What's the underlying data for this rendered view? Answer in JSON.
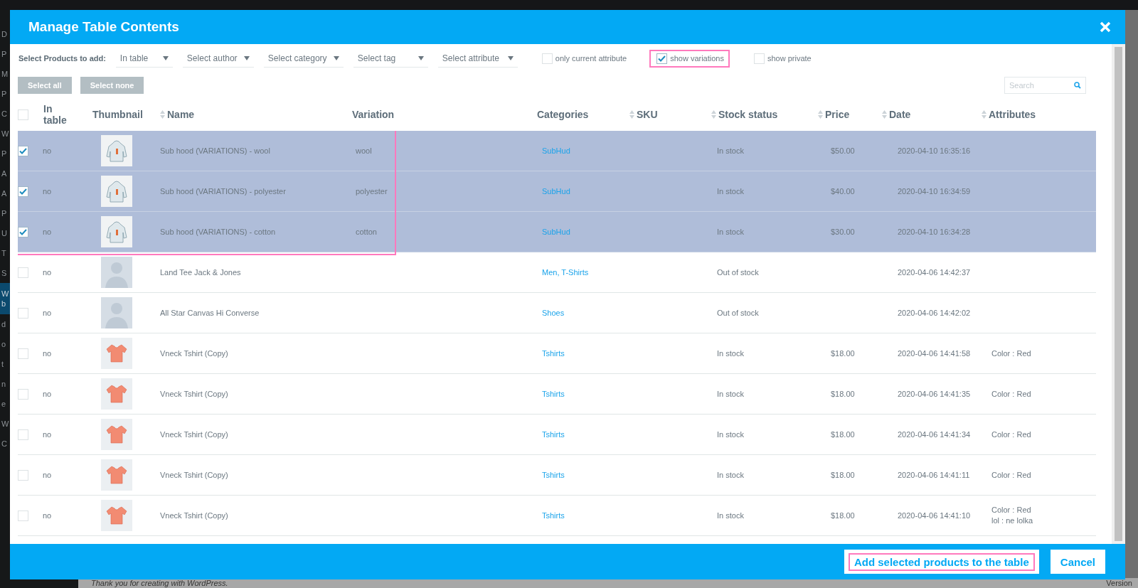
{
  "admin_sidebar": {
    "items": [
      {
        "label": "D",
        "current": false
      },
      {
        "label": "P",
        "current": false
      },
      {
        "label": "M",
        "current": false
      },
      {
        "label": "P",
        "current": false
      },
      {
        "label": "C",
        "current": false
      },
      {
        "label": "W",
        "current": false
      },
      {
        "label": "P",
        "current": false
      },
      {
        "label": "A",
        "current": false
      },
      {
        "label": "A",
        "current": false
      },
      {
        "label": "P",
        "current": false
      },
      {
        "label": "U",
        "current": false
      },
      {
        "label": "T",
        "current": false
      },
      {
        "label": "S",
        "current": false
      },
      {
        "label": "W\nb",
        "current": true
      },
      {
        "label": "d",
        "current": false
      },
      {
        "label": "o",
        "current": false
      },
      {
        "label": "t",
        "current": false
      },
      {
        "label": "n",
        "current": false
      },
      {
        "label": "e",
        "current": false
      },
      {
        "label": "W",
        "current": false
      },
      {
        "label": "C",
        "current": false
      }
    ]
  },
  "page_footer": {
    "text": "Thank you for creating with WordPress.",
    "version": "Version"
  },
  "dialog": {
    "title": "Manage Table Contents",
    "filters": {
      "label": "Select Products to add:",
      "dropdowns": [
        "In table",
        "Select author",
        "Select category",
        "Select tag",
        "Select attribute"
      ],
      "checkboxes": [
        {
          "label": "only current attribute",
          "checked": false,
          "highlighted": false
        },
        {
          "label": "show variations",
          "checked": true,
          "highlighted": true
        },
        {
          "label": "show private",
          "checked": false,
          "highlighted": false
        }
      ]
    },
    "buttons": [
      "Select all",
      "Select none"
    ],
    "search": {
      "placeholder": "Search"
    },
    "table": {
      "columns": [
        {
          "kind": "checkbox",
          "checked": false
        },
        {
          "label": "In table",
          "sortable": false
        },
        {
          "label": "Thumbnail",
          "sortable": false
        },
        {
          "label": "Name",
          "sortable": true
        },
        {
          "label": "Variation",
          "sortable": false
        },
        {
          "label": "Categories",
          "sortable": false
        },
        {
          "label": "SKU",
          "sortable": true
        },
        {
          "label": "Stock status",
          "sortable": true
        },
        {
          "label": "Price",
          "sortable": true
        },
        {
          "label": "Date",
          "sortable": true
        },
        {
          "label": "Attributes",
          "sortable": true
        }
      ],
      "rows": [
        {
          "selected": true,
          "highlighted": true,
          "in_table": "no",
          "thumbnail": {
            "kind": "hoodie"
          },
          "name": "Sub hood (VARIATIONS) - wool",
          "variation": "wool",
          "categories": "SubHud",
          "stock": "In stock",
          "price": "$50.00",
          "date": "2020-04-10 16:35:16",
          "attributes": []
        },
        {
          "selected": true,
          "highlighted": true,
          "in_table": "no",
          "thumbnail": {
            "kind": "hoodie"
          },
          "name": "Sub hood (VARIATIONS) - polyester",
          "variation": "polyester",
          "categories": "SubHud",
          "stock": "In stock",
          "price": "$40.00",
          "date": "2020-04-10 16:34:59",
          "attributes": []
        },
        {
          "selected": true,
          "highlighted": true,
          "in_table": "no",
          "thumbnail": {
            "kind": "hoodie"
          },
          "name": "Sub hood (VARIATIONS) - cotton",
          "variation": "cotton",
          "categories": "SubHud",
          "stock": "In stock",
          "price": "$30.00",
          "date": "2020-04-10 16:34:28",
          "attributes": []
        },
        {
          "selected": false,
          "highlighted": false,
          "in_table": "no",
          "thumbnail": {
            "kind": "placeholder"
          },
          "name": "Land Tee Jack & Jones",
          "variation": "",
          "categories": "Men, T-Shirts",
          "stock": "Out of stock",
          "price": "",
          "date": "2020-04-06 14:42:37",
          "attributes": []
        },
        {
          "selected": false,
          "highlighted": false,
          "in_table": "no",
          "thumbnail": {
            "kind": "placeholder"
          },
          "name": "All Star Canvas Hi Converse",
          "variation": "",
          "categories": "Shoes",
          "stock": "Out of stock",
          "price": "",
          "date": "2020-04-06 14:42:02",
          "attributes": []
        },
        {
          "selected": false,
          "highlighted": false,
          "in_table": "no",
          "thumbnail": {
            "kind": "tshirt"
          },
          "name": "Vneck Tshirt (Copy)",
          "variation": "",
          "categories": "Tshirts",
          "stock": "In stock",
          "price": "$18.00",
          "date": "2020-04-06 14:41:58",
          "attributes": [
            "Color : Red"
          ]
        },
        {
          "selected": false,
          "highlighted": false,
          "in_table": "no",
          "thumbnail": {
            "kind": "tshirt"
          },
          "name": "Vneck Tshirt (Copy)",
          "variation": "",
          "categories": "Tshirts",
          "stock": "In stock",
          "price": "$18.00",
          "date": "2020-04-06 14:41:35",
          "attributes": [
            "Color : Red"
          ]
        },
        {
          "selected": false,
          "highlighted": false,
          "in_table": "no",
          "thumbnail": {
            "kind": "tshirt"
          },
          "name": "Vneck Tshirt (Copy)",
          "variation": "",
          "categories": "Tshirts",
          "stock": "In stock",
          "price": "$18.00",
          "date": "2020-04-06 14:41:34",
          "attributes": [
            "Color : Red"
          ]
        },
        {
          "selected": false,
          "highlighted": false,
          "in_table": "no",
          "thumbnail": {
            "kind": "tshirt"
          },
          "name": "Vneck Tshirt (Copy)",
          "variation": "",
          "categories": "Tshirts",
          "stock": "In stock",
          "price": "$18.00",
          "date": "2020-04-06 14:41:11",
          "attributes": [
            "Color : Red"
          ]
        },
        {
          "selected": false,
          "highlighted": false,
          "in_table": "no",
          "thumbnail": {
            "kind": "tshirt"
          },
          "name": "Vneck Tshirt (Copy)",
          "variation": "",
          "categories": "Tshirts",
          "stock": "In stock",
          "price": "$18.00",
          "date": "2020-04-06 14:41:10",
          "attributes": [
            "Color : Red",
            "lol : ne lolka"
          ]
        }
      ]
    },
    "actions": [
      {
        "label": "Add selected products to the table",
        "highlighted": true
      },
      {
        "label": "Cancel",
        "highlighted": false
      }
    ]
  }
}
